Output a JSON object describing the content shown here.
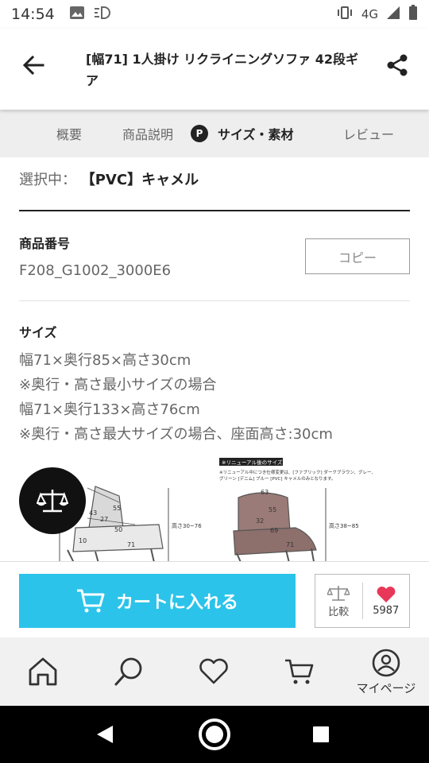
{
  "status_bar": {
    "time": "14:54",
    "network": "4G"
  },
  "header": {
    "title": "[幅71] 1人掛け リクライニングソファ 42段ギア"
  },
  "tabs": [
    {
      "label": "概要",
      "active": false
    },
    {
      "label": "商品説明",
      "active": false
    },
    {
      "label": "サイズ・素材",
      "active": true,
      "badge": "P"
    },
    {
      "label": "レビュー",
      "active": false
    }
  ],
  "selection": {
    "label": "選択中：",
    "value": "【PVC】キャメル"
  },
  "product_number": {
    "heading": "商品番号",
    "value": "F208_G1002_3000E6",
    "copy_label": "コピー"
  },
  "size": {
    "heading": "サイズ",
    "lines": [
      "幅71×奥行85×高さ30cm",
      "※奥行・高さ最小サイズの場合",
      "幅71×奥行133×高さ76cm",
      "※奥行・高さ最大サイズの場合、座面高さ:30cm"
    ]
  },
  "diagram": {
    "dims_left": [
      "55",
      "43",
      "27",
      "50",
      "10",
      "71"
    ],
    "dims_right": [
      "63",
      "55",
      "32",
      "69",
      "71"
    ],
    "height_left": "高さ30~76",
    "height_right": "高さ38~85",
    "renewal_title": "※リニューアル後のサイズ",
    "renewal_note_1": "※リニューアル中につき仕様変更は、[ファブリック] ダークブラウン、グレー、",
    "renewal_note_2": "グリーン [デニム] ブルー [PVC] キャメルのみとなります。"
  },
  "actions": {
    "cart_label": "カートに入れる",
    "compare_label": "比較",
    "favorite_count": "5987",
    "accent_color": "#2bc3ea",
    "heart_color": "#e8385a"
  },
  "bottom_nav": {
    "mypage_label": "マイページ",
    "icons": [
      "home-icon",
      "search-icon",
      "heart-icon",
      "cart-icon",
      "user-icon"
    ]
  }
}
